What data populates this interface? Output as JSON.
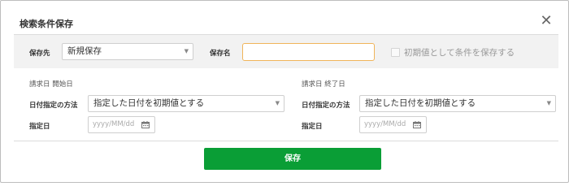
{
  "dialog": {
    "title": "検索条件保存",
    "close_symbol": "✕"
  },
  "save_bar": {
    "destination_label": "保存先",
    "destination_value": "新規保存",
    "name_label": "保存名",
    "name_value": "",
    "default_checkbox_label": "初期値として条件を保存する",
    "default_checked": false
  },
  "start_date": {
    "section_title": "請求日 開始日",
    "method_label": "日付指定の方法",
    "method_value": "指定した日付を初期値とする",
    "date_label": "指定日",
    "date_placeholder": "yyyy/MM/dd"
  },
  "end_date": {
    "section_title": "請求日 終了日",
    "method_label": "日付指定の方法",
    "method_value": "指定した日付を初期値とする",
    "date_label": "指定日",
    "date_placeholder": "yyyy/MM/dd"
  },
  "footer": {
    "save_label": "保存"
  },
  "colors": {
    "primary": "#0a9e36",
    "focus_border": "#f0b45a",
    "band_bg": "#f2f2f2"
  }
}
